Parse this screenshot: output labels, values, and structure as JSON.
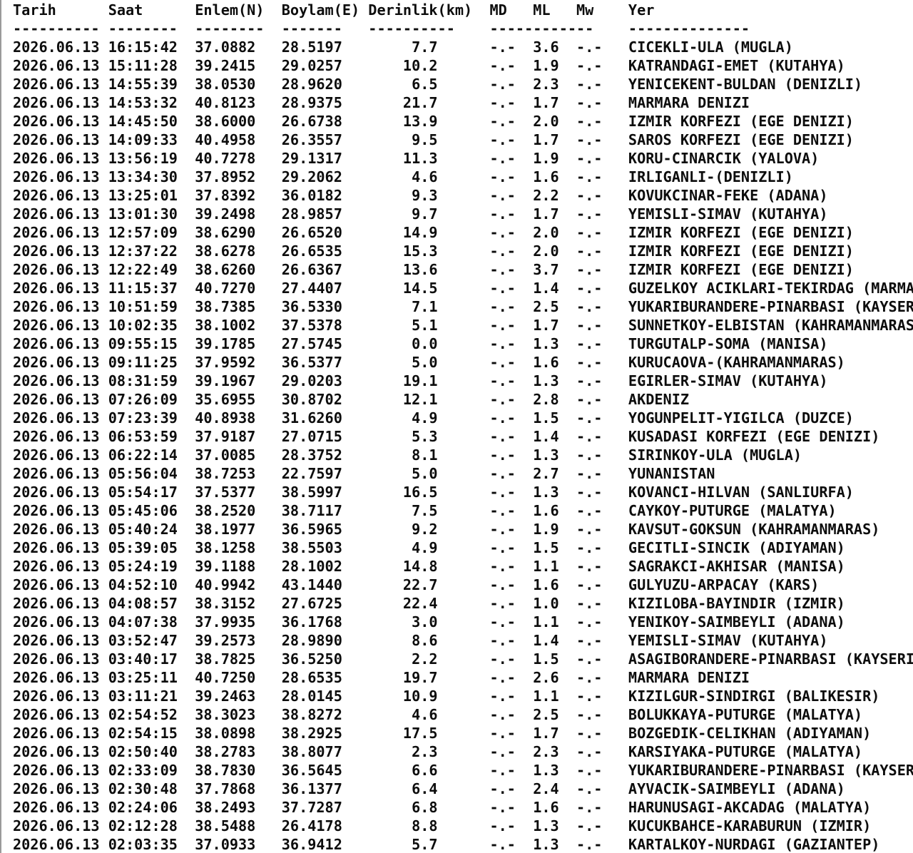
{
  "header_line": "Tarih      Saat      Enlem(N)  Boylam(E) Derinlik(km)  MD   ML   Mw    Yer",
  "separator_line": "---------- --------  --------  -------   ----------    ------------    --------------",
  "rows": [
    "2026.06.13 16:15:42  37.0882   28.5197        7.7      -.-  3.6  -.-   CICEKLI-ULA (MUGLA)",
    "2026.06.13 15:11:28  39.2415   29.0257       10.2      -.-  1.9  -.-   KATRANDAGI-EMET (KUTAHYA)",
    "2026.06.13 14:55:39  38.0530   28.9620        6.5      -.-  2.3  -.-   YENICEKENT-BULDAN (DENIZLI)",
    "2026.06.13 14:53:32  40.8123   28.9375       21.7      -.-  1.7  -.-   MARMARA DENIZI",
    "2026.06.13 14:45:50  38.6000   26.6738       13.9      -.-  2.0  -.-   IZMIR KORFEZI (EGE DENIZI)",
    "2026.06.13 14:09:33  40.4958   26.3557        9.5      -.-  1.7  -.-   SAROS KORFEZI (EGE DENIZI)",
    "2026.06.13 13:56:19  40.7278   29.1317       11.3      -.-  1.9  -.-   KORU-CINARCIK (YALOVA)",
    "2026.06.13 13:34:30  37.8952   29.2062        4.6      -.-  1.6  -.-   IRLIGANLI-(DENIZLI)",
    "2026.06.13 13:25:01  37.8392   36.0182        9.3      -.-  2.2  -.-   KOVUKCINAR-FEKE (ADANA)",
    "2026.06.13 13:01:30  39.2498   28.9857        9.7      -.-  1.7  -.-   YEMISLI-SIMAV (KUTAHYA)",
    "2026.06.13 12:57:09  38.6290   26.6520       14.9      -.-  2.0  -.-   IZMIR KORFEZI (EGE DENIZI)",
    "2026.06.13 12:37:22  38.6278   26.6535       15.3      -.-  2.0  -.-   IZMIR KORFEZI (EGE DENIZI)",
    "2026.06.13 12:22:49  38.6260   26.6367       13.6      -.-  3.7  -.-   IZMIR KORFEZI (EGE DENIZI)",
    "2026.06.13 11:15:37  40.7270   27.4407       14.5      -.-  1.4  -.-   GUZELKOY ACIKLARI-TEKIRDAG (MARMA",
    "2026.06.13 10:51:59  38.7385   36.5330        7.1      -.-  2.5  -.-   YUKARIBURANDERE-PINARBASI (KAYSER",
    "2026.06.13 10:02:35  38.1002   37.5378        5.1      -.-  1.7  -.-   SUNNETKOY-ELBISTAN (KAHRAMANMARAS",
    "2026.06.13 09:55:15  39.1785   27.5745        0.0      -.-  1.3  -.-   TURGUTALP-SOMA (MANISA)",
    "2026.06.13 09:11:25  37.9592   36.5377        5.0      -.-  1.6  -.-   KURUCAOVA-(KAHRAMANMARAS)",
    "2026.06.13 08:31:59  39.1967   29.0203       19.1      -.-  1.3  -.-   EGIRLER-SIMAV (KUTAHYA)",
    "2026.06.13 07:26:09  35.6955   30.8702       12.1      -.-  2.8  -.-   AKDENIZ",
    "2026.06.13 07:23:39  40.8938   31.6260        4.9      -.-  1.5  -.-   YOGUNPELIT-YIGILCA (DUZCE)",
    "2026.06.13 06:53:59  37.9187   27.0715        5.3      -.-  1.4  -.-   KUSADASI KORFEZI (EGE DENIZI)",
    "2026.06.13 06:22:14  37.0085   28.3752        8.1      -.-  1.3  -.-   SIRINKOY-ULA (MUGLA)",
    "2026.06.13 05:56:04  38.7253   22.7597        5.0      -.-  2.7  -.-   YUNANISTAN",
    "2026.06.13 05:54:17  37.5377   38.5997       16.5      -.-  1.3  -.-   KOVANCI-HILVAN (SANLIURFA)",
    "2026.06.13 05:45:06  38.2520   38.7117        7.5      -.-  1.6  -.-   CAYKOY-PUTURGE (MALATYA)",
    "2026.06.13 05:40:24  38.1977   36.5965        9.2      -.-  1.9  -.-   KAVSUT-GOKSUN (KAHRAMANMARAS)",
    "2026.06.13 05:39:05  38.1258   38.5503        4.9      -.-  1.5  -.-   GECITLI-SINCIK (ADIYAMAN)",
    "2026.06.13 05:24:19  39.1188   28.1002       14.8      -.-  1.1  -.-   SAGRAKCI-AKHISAR (MANISA)",
    "2026.06.13 04:52:10  40.9942   43.1440       22.7      -.-  1.6  -.-   GULYUZU-ARPACAY (KARS)",
    "2026.06.13 04:08:57  38.3152   27.6725       22.4      -.-  1.0  -.-   KIZILOBA-BAYINDIR (IZMIR)",
    "2026.06.13 04:07:38  37.9935   36.1768        3.0      -.-  1.1  -.-   YENIKOY-SAIMBEYLI (ADANA)",
    "2026.06.13 03:52:47  39.2573   28.9890        8.6      -.-  1.4  -.-   YEMISLI-SIMAV (KUTAHYA)",
    "2026.06.13 03:40:17  38.7825   36.5250        2.2      -.-  1.5  -.-   ASAGIBORANDERE-PINARBASI (KAYSERI",
    "2026.06.13 03:25:11  40.7250   28.6535       19.7      -.-  2.6  -.-   MARMARA DENIZI",
    "2026.06.13 03:11:21  39.2463   28.0145       10.9      -.-  1.1  -.-   KIZILGUR-SINDIRGI (BALIKESIR)",
    "2026.06.13 02:54:52  38.3023   38.8272        4.6      -.-  2.5  -.-   BOLUKKAYA-PUTURGE (MALATYA)",
    "2026.06.13 02:54:15  38.0898   38.2925       17.5      -.-  1.7  -.-   BOZGEDIK-CELIKHAN (ADIYAMAN)",
    "2026.06.13 02:50:40  38.2783   38.8077        2.3      -.-  2.3  -.-   KARSIYAKA-PUTURGE (MALATYA)",
    "2026.06.13 02:33:09  38.7830   36.5645        6.6      -.-  1.3  -.-   YUKARIBURANDERE-PINARBASI (KAYSER",
    "2026.06.13 02:30:48  37.7868   36.1377        6.4      -.-  2.4  -.-   AYVACIK-SAIMBEYLI (ADANA)",
    "2026.06.13 02:24:06  38.2493   37.7287        6.8      -.-  1.6  -.-   HARUNUSAGI-AKCADAG (MALATYA)",
    "2026.06.13 02:12:28  38.5488   26.4178        8.8      -.-  1.3  -.-   KUCUKBAHCE-KARABURUN (IZMIR)",
    "2026.06.13 02:03:35  37.0933   36.9412        5.7      -.-  1.3  -.-   KARTALKOY-NURDAGI (GAZIANTEP)"
  ]
}
